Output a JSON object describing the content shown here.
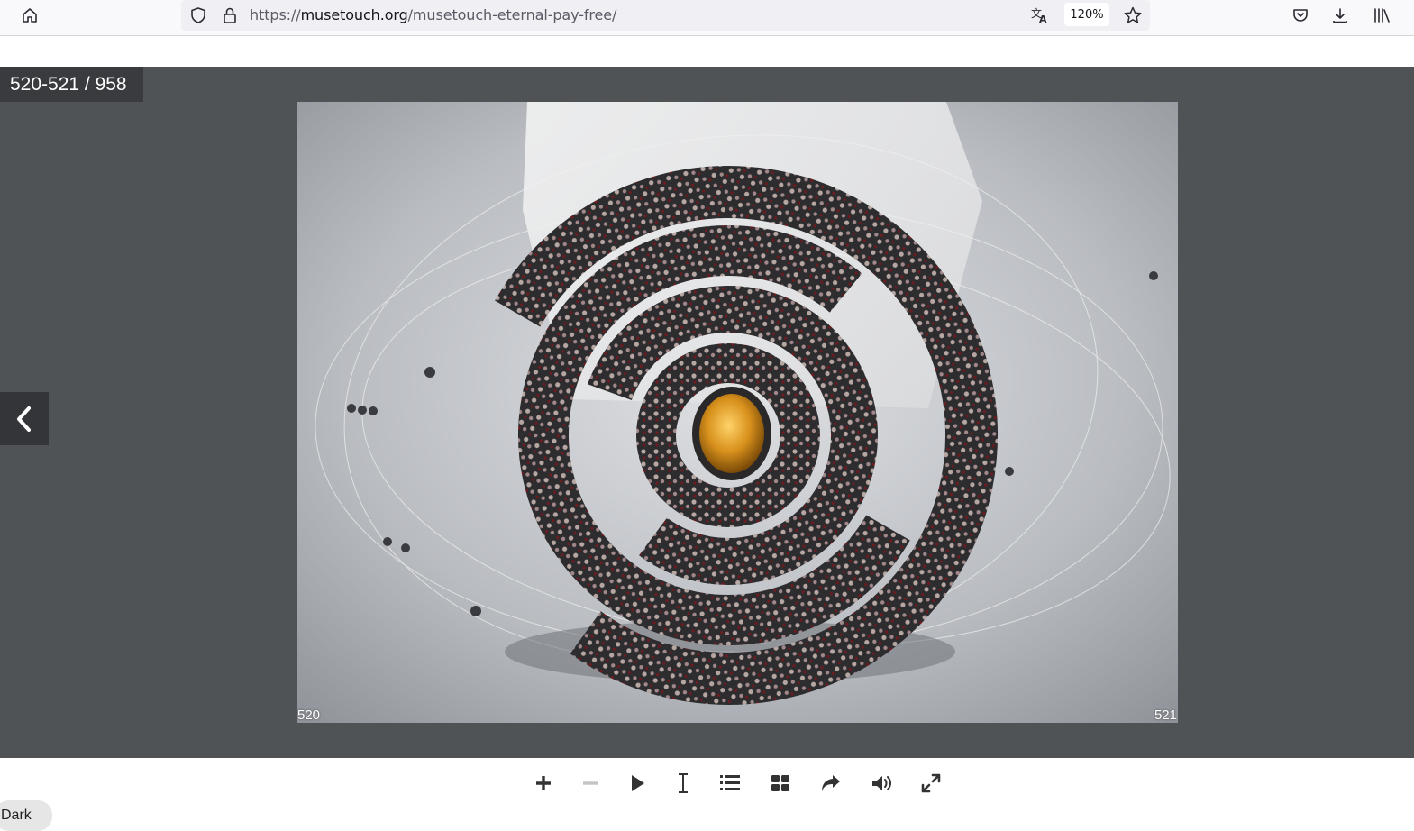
{
  "browser": {
    "url_prefix": "https://",
    "url_domain": "musetouch.org",
    "url_path": "/musetouch-eternal-pay-free/",
    "zoom_label": "120%"
  },
  "viewer": {
    "page_counter": "520-521 / 958",
    "left_page_number": "520",
    "right_page_number": "521",
    "background_color": "#4f5356"
  },
  "controls": {
    "icons": [
      "zoom-in-icon",
      "zoom-out-icon",
      "play-icon",
      "text-select-icon",
      "table-of-contents-icon",
      "thumbnails-icon",
      "share-icon",
      "sound-icon",
      "fullscreen-icon"
    ]
  },
  "theme_toggle": {
    "label": "Dark"
  }
}
